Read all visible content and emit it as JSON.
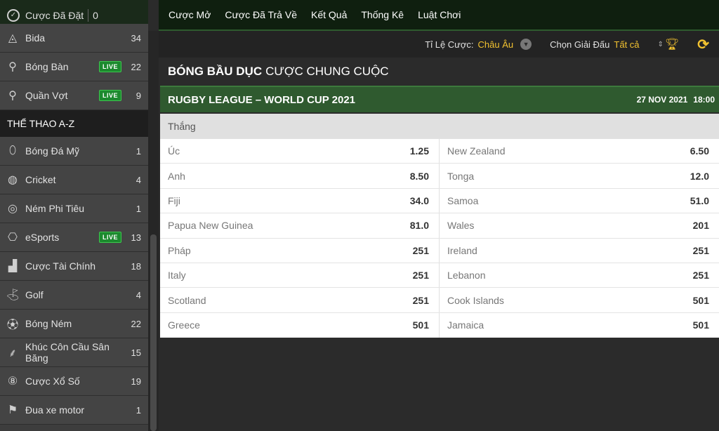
{
  "sidebar": {
    "bets_placed_label": "Cược Đã Đặt",
    "bets_placed_count": "0",
    "top_items": [
      {
        "label": "Bida",
        "count": "34",
        "live": false,
        "icon": "pool-table-icon"
      },
      {
        "label": "Bóng Bàn",
        "count": "22",
        "live": true,
        "icon": "table-tennis-icon"
      },
      {
        "label": "Quần Vợt",
        "count": "9",
        "live": true,
        "icon": "tennis-icon"
      }
    ],
    "az_header": "THỂ THAO A-Z",
    "az_items": [
      {
        "label": "Bóng Đá Mỹ",
        "count": "1",
        "live": false,
        "icon": "american-football-icon"
      },
      {
        "label": "Cricket",
        "count": "4",
        "live": false,
        "icon": "cricket-ball-icon"
      },
      {
        "label": "Ném Phi Tiêu",
        "count": "1",
        "live": false,
        "icon": "darts-icon"
      },
      {
        "label": "eSports",
        "count": "13",
        "live": true,
        "icon": "gamepad-icon"
      },
      {
        "label": "Cược Tài Chính",
        "count": "18",
        "live": false,
        "icon": "finance-chart-icon"
      },
      {
        "label": "Golf",
        "count": "4",
        "live": false,
        "icon": "golf-icon"
      },
      {
        "label": "Bóng Ném",
        "count": "22",
        "live": false,
        "icon": "handball-icon"
      },
      {
        "label": "Khúc Côn Cầu Sân Băng",
        "count": "15",
        "live": false,
        "icon": "ice-hockey-icon"
      },
      {
        "label": "Cược Xổ Số",
        "count": "19",
        "live": false,
        "icon": "lottery-ball-icon"
      },
      {
        "label": "Đua xe motor",
        "count": "1",
        "live": false,
        "icon": "checkered-flag-icon"
      }
    ],
    "live_label": "LIVE"
  },
  "topnav": {
    "links": [
      "Cược Mở",
      "Cược Đã Trả Về",
      "Kết Quả",
      "Thống Kê",
      "Luật Chơi"
    ]
  },
  "filters": {
    "odds_label": "Tỉ Lệ Cược:",
    "odds_value": "Châu Âu",
    "league_label": "Chọn Giải Đấu",
    "league_value": "Tất cả"
  },
  "market": {
    "sport": "BÓNG BẦU DỤC",
    "type": "CƯỢC CHUNG CUỘC"
  },
  "event": {
    "name": "RUGBY LEAGUE – WORLD CUP 2021",
    "date": "27 NOV 2021",
    "time": "18:00"
  },
  "selection_header": "Thắng",
  "odds_rows": [
    [
      {
        "team": "Úc",
        "price": "1.25"
      },
      {
        "team": "New Zealand",
        "price": "6.50"
      }
    ],
    [
      {
        "team": "Anh",
        "price": "8.50"
      },
      {
        "team": "Tonga",
        "price": "12.0"
      }
    ],
    [
      {
        "team": "Fiji",
        "price": "34.0"
      },
      {
        "team": "Samoa",
        "price": "51.0"
      }
    ],
    [
      {
        "team": "Papua New Guinea",
        "price": "81.0"
      },
      {
        "team": "Wales",
        "price": "201"
      }
    ],
    [
      {
        "team": "Pháp",
        "price": "251"
      },
      {
        "team": "Ireland",
        "price": "251"
      }
    ],
    [
      {
        "team": "Italy",
        "price": "251"
      },
      {
        "team": "Lebanon",
        "price": "251"
      }
    ],
    [
      {
        "team": "Scotland",
        "price": "251"
      },
      {
        "team": "Cook Islands",
        "price": "501"
      }
    ],
    [
      {
        "team": "Greece",
        "price": "501"
      },
      {
        "team": "Jamaica",
        "price": "501"
      }
    ]
  ],
  "colors": {
    "accent_yellow": "#f2c230",
    "live_green": "#1c8a2e",
    "event_header_green": "#2f5a2f"
  }
}
